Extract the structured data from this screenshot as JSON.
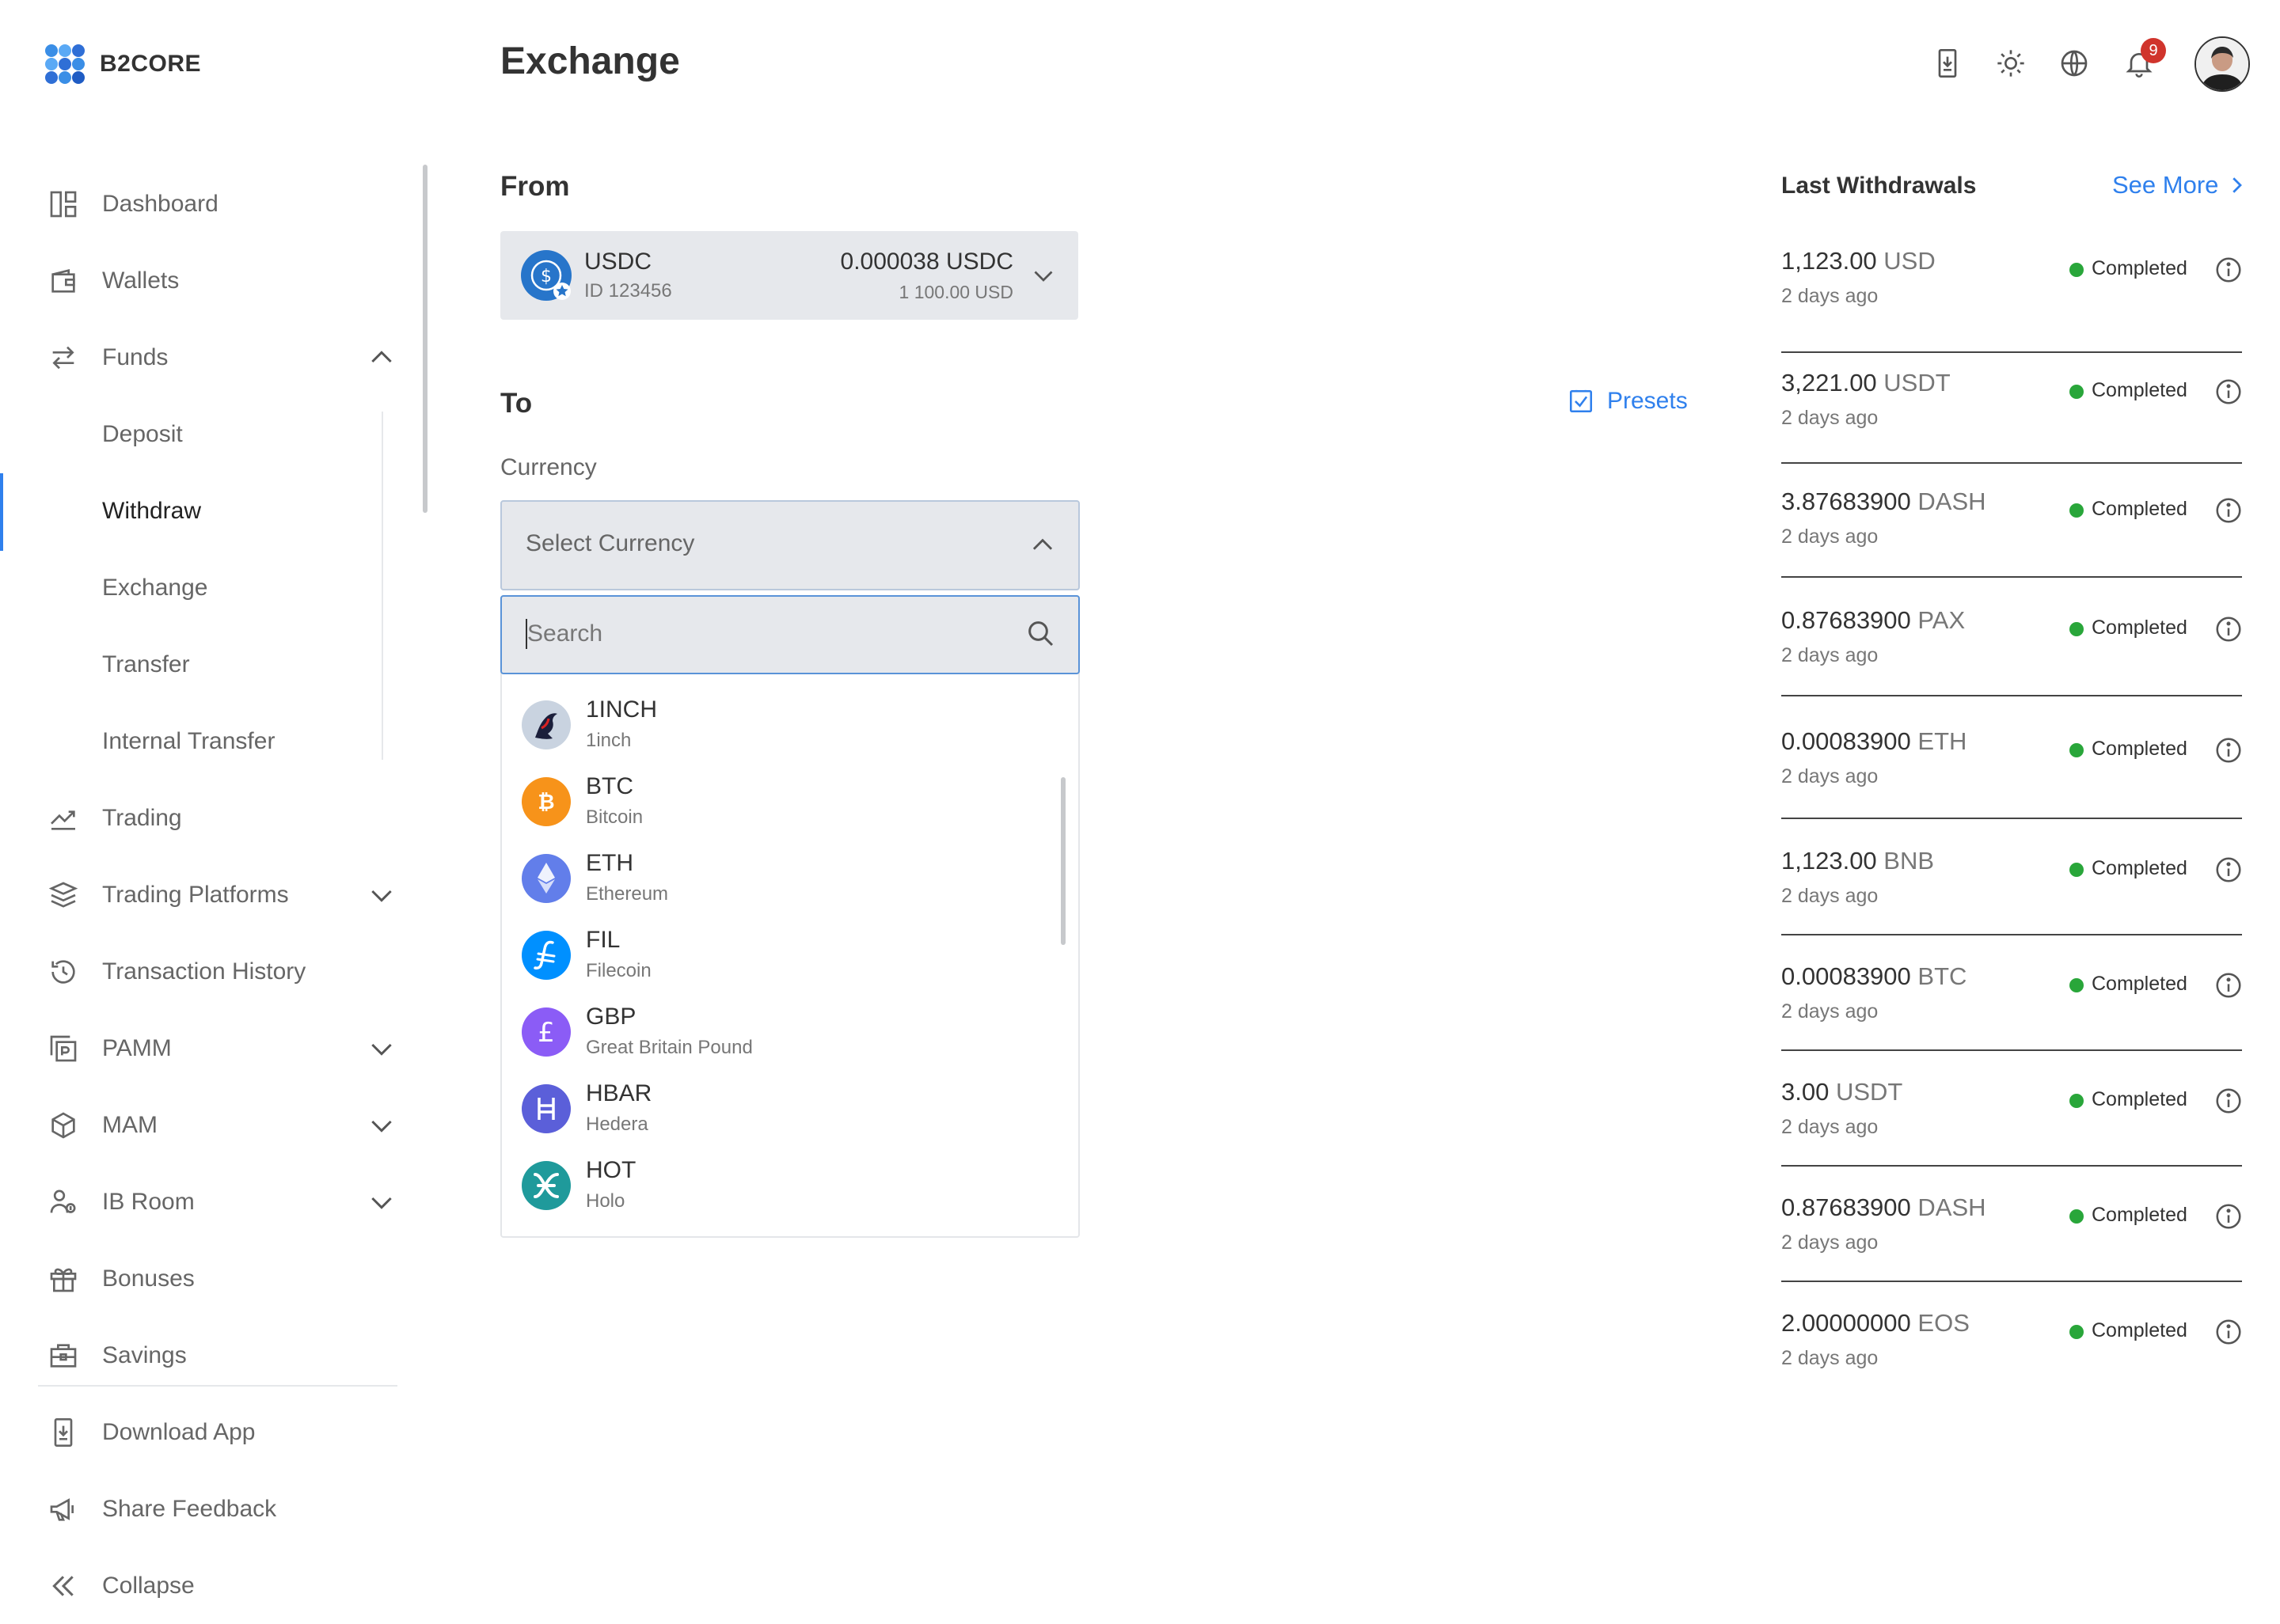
{
  "app": {
    "brand": "B2CORE",
    "page_title": "Exchange",
    "notification_count": "9"
  },
  "sidebar": {
    "items": [
      {
        "label": "Dashboard",
        "icon": "dashboard-icon"
      },
      {
        "label": "Wallets",
        "icon": "wallet-icon"
      },
      {
        "label": "Funds",
        "icon": "transfer-arrows-icon",
        "expanded": true
      },
      {
        "label": "Deposit",
        "sub": true
      },
      {
        "label": "Withdraw",
        "sub": true,
        "active": true
      },
      {
        "label": "Exchange",
        "sub": true
      },
      {
        "label": "Transfer",
        "sub": true
      },
      {
        "label": "Internal Transfer",
        "sub": true
      },
      {
        "label": "Trading",
        "icon": "chart-line-icon"
      },
      {
        "label": "Trading Platforms",
        "icon": "layers-icon"
      },
      {
        "label": "Transaction History",
        "icon": "history-icon"
      },
      {
        "label": "PAMM",
        "icon": "pamm-icon"
      },
      {
        "label": "MAM",
        "icon": "cube-icon"
      },
      {
        "label": "IB Room",
        "icon": "ib-room-icon"
      },
      {
        "label": "Bonuses",
        "icon": "gift-icon"
      },
      {
        "label": "Savings",
        "icon": "briefcase-icon"
      },
      {
        "label": "Download App",
        "icon": "download-icon"
      },
      {
        "label": "Share Feedback",
        "icon": "megaphone-icon"
      },
      {
        "label": "Collapse",
        "icon": "double-chevron-left-icon"
      }
    ]
  },
  "from": {
    "title": "From",
    "currency": "USDC",
    "account_id": "ID 123456",
    "balance": "0.000038 USDC",
    "balance_usd": "1 100.00 USD"
  },
  "to": {
    "title": "To",
    "presets_label": "Presets",
    "currency_label": "Currency",
    "select_placeholder": "Select Currency",
    "search_placeholder": "Search",
    "options": [
      {
        "code": "1INCH",
        "name": "1inch",
        "color": "#c9d3e0",
        "glyph": "🦄"
      },
      {
        "code": "BTC",
        "name": "Bitcoin",
        "color": "#f7931a",
        "glyph": "₿"
      },
      {
        "code": "ETH",
        "name": "Ethereum",
        "color": "#627eea",
        "glyph": "Ξ"
      },
      {
        "code": "FIL",
        "name": "Filecoin",
        "color": "#0090ff",
        "glyph": "⨍"
      },
      {
        "code": "GBP",
        "name": "Great Britain Pound",
        "color": "#8b5cf6",
        "glyph": "£"
      },
      {
        "code": "HBAR",
        "name": "Hedera",
        "color": "#5b5fd9",
        "glyph": "H"
      },
      {
        "code": "HOT",
        "name": "Holo",
        "color": "#1f9a9b",
        "glyph": "✕"
      }
    ]
  },
  "withdrawals": {
    "title": "Last Withdrawals",
    "see_more": "See More",
    "status_color": "#29a63a",
    "items": [
      {
        "amount": "1,123.00",
        "unit": "USD",
        "when": "2 days ago",
        "status": "Completed"
      },
      {
        "amount": "3,221.00",
        "unit": "USDT",
        "when": "2 days ago",
        "status": "Completed"
      },
      {
        "amount": "3.87683900",
        "unit": "DASH",
        "when": "2 days ago",
        "status": "Completed"
      },
      {
        "amount": "0.87683900",
        "unit": "PAX",
        "when": "2 days ago",
        "status": "Completed"
      },
      {
        "amount": "0.00083900",
        "unit": "ETH",
        "when": "2 days ago",
        "status": "Completed"
      },
      {
        "amount": "1,123.00",
        "unit": "BNB",
        "when": "2 days ago",
        "status": "Completed"
      },
      {
        "amount": "0.00083900",
        "unit": "BTC",
        "when": "2 days ago",
        "status": "Completed"
      },
      {
        "amount": "3.00",
        "unit": "USDT",
        "when": "2 days ago",
        "status": "Completed"
      },
      {
        "amount": "0.87683900",
        "unit": "DASH",
        "when": "2 days ago",
        "status": "Completed"
      },
      {
        "amount": "2.00000000",
        "unit": "EOS",
        "when": "2 days ago",
        "status": "Completed"
      }
    ]
  },
  "colors": {
    "accent": "#2f80ed",
    "badge": "#d0342c"
  }
}
